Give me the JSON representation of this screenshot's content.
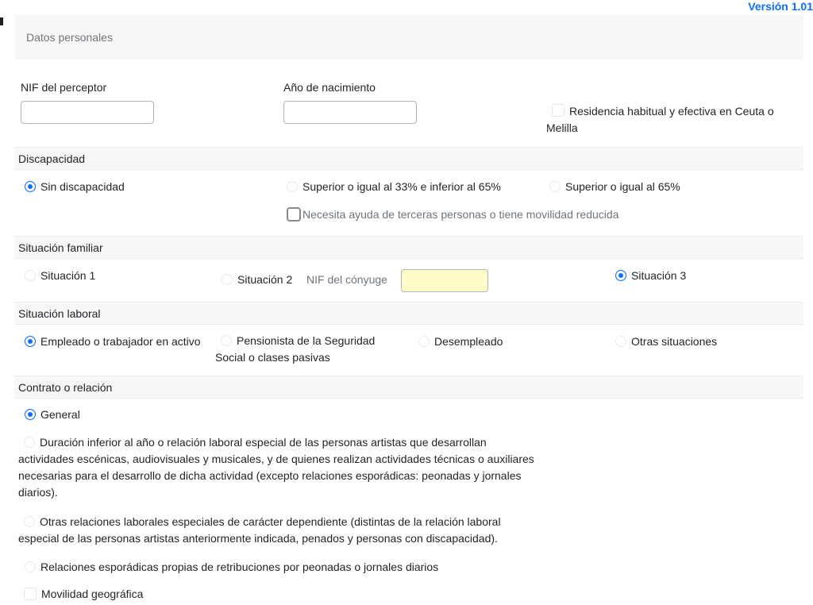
{
  "version": "Versión 1.01",
  "header": {
    "title": "Datos personales"
  },
  "personal": {
    "nif_label": "NIF del perceptor",
    "nif_value": "",
    "birth_label": "Año de nacimiento",
    "birth_value": "",
    "residence_label": "Residencia habitual y efectiva en Ceuta o Melilla",
    "residence_checked": false
  },
  "discapacidad": {
    "title": "Discapacidad",
    "options": [
      {
        "label": "Sin discapacidad",
        "selected": true
      },
      {
        "label": "Superior o igual al 33% e inferior al 65%",
        "selected": false
      },
      {
        "label": "Superior o igual al 65%",
        "selected": false
      }
    ],
    "help_label": "Necesita ayuda de terceras personas o tiene movilidad reducida",
    "help_checked": false
  },
  "familiar": {
    "title": "Situación familiar",
    "options": [
      {
        "label": "Situación 1",
        "selected": false
      },
      {
        "label": "Situación 2",
        "selected": false
      },
      {
        "label": "Situación 3",
        "selected": true
      }
    ],
    "spouse_nif_label": "NIF del cónyuge",
    "spouse_nif_value": ""
  },
  "laboral": {
    "title": "Situación laboral",
    "options": [
      {
        "label": "Empleado o trabajador en activo",
        "selected": true
      },
      {
        "label": "Pensionista de la Seguridad Social o clases pasivas",
        "selected": false
      },
      {
        "label": "Desempleado",
        "selected": false
      },
      {
        "label": "Otras situaciones",
        "selected": false
      }
    ]
  },
  "contrato": {
    "title": "Contrato o relación",
    "options": [
      {
        "label": "General",
        "selected": true
      },
      {
        "label": "Duración inferior al año o relación laboral especial de las personas artistas que desarrollan actividades escénicas, audiovisuales y musicales, y de quienes realizan actividades técnicas o auxiliares necesarias para el desarrollo de dicha actividad (excepto relaciones esporádicas: peonadas y jornales diarios).",
        "selected": false
      },
      {
        "label": "Otras relaciones laborales especiales de carácter dependiente (distintas de la relación laboral especial de las personas artistas anteriormente indicada, penados y personas con discapacidad).",
        "selected": false
      },
      {
        "label": "Relaciones esporádicas propias de retribuciones por peonadas o jornales diarios",
        "selected": false
      }
    ],
    "mobility_label": "Movilidad geográfica",
    "mobility_checked": false
  }
}
